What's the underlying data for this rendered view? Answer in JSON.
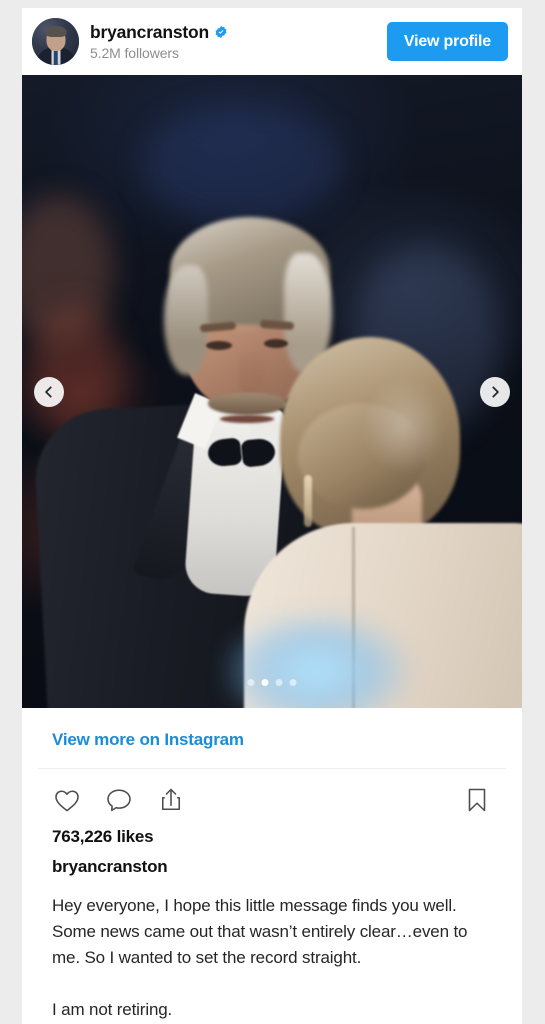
{
  "theme": {
    "page_background": "#ececec",
    "card_background": "#ffffff",
    "primary_blue": "#1d9bf0",
    "link_blue": "#1a8cd8",
    "verified_blue": "#1d9bf0",
    "text_primary": "#111111",
    "text_secondary": "#8e8e8e"
  },
  "header": {
    "avatar_name": "bryancranston-avatar",
    "username": "bryancranston",
    "verified": true,
    "verified_icon": "verified-badge-icon",
    "followers": "5.2M followers",
    "view_profile_label": "View profile"
  },
  "media": {
    "alt": "Man in tuxedo with grey hair and moustache greeting a woman seen from behind wearing a cream coat on a red carpet",
    "prev_icon": "chevron-left-icon",
    "next_icon": "chevron-right-icon",
    "carousel": {
      "total": 4,
      "active_index": 1
    }
  },
  "body": {
    "view_more_label": "View more on Instagram",
    "actions": {
      "like_icon": "heart-icon",
      "comment_icon": "comment-bubble-icon",
      "share_icon": "share-icon",
      "save_icon": "bookmark-icon"
    },
    "likes": "763,226 likes",
    "caption_username": "bryancranston",
    "caption": "Hey everyone, I hope this little message finds you well. Some news came out that wasn’t entirely clear…even to me. So I wanted to set the record straight.\n\nI am not retiring."
  }
}
